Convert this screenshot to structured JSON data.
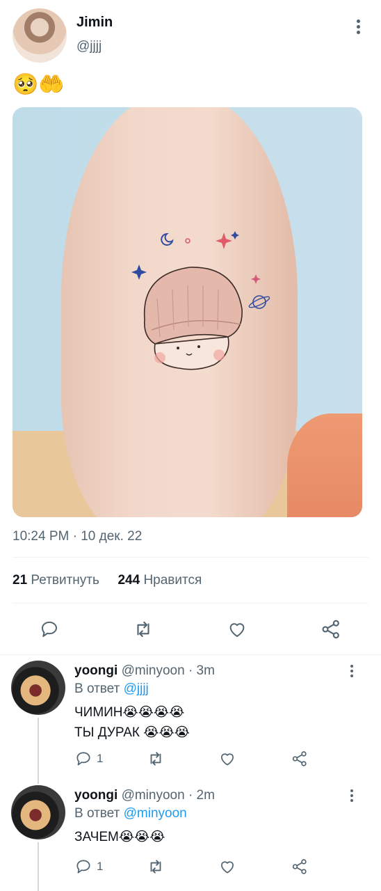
{
  "tweet": {
    "author_name": "Jimin",
    "author_handle": "@jjjj",
    "text": "🥺🤲",
    "timestamp": "10:24 PM · 10 дек. 22",
    "retweets_count": "21",
    "retweets_label": "Ретвитнуть",
    "likes_count": "244",
    "likes_label": "Нравится"
  },
  "actions": [
    "reply-icon",
    "retweet-icon",
    "like-icon",
    "share-icon"
  ],
  "replies": [
    {
      "author_name": "yoongi",
      "author_handle": "@minyoon · 3m",
      "in_reply_prefix": "В ответ ",
      "in_reply_to": "@jjjj",
      "text": "ЧИМИН😭😭😭😭\nТЫ ДУРАК 😭😭😭",
      "reply_count": "1"
    },
    {
      "author_name": "yoongi",
      "author_handle": "@minyoon · 2m",
      "in_reply_prefix": "В ответ ",
      "in_reply_to": "@minyoon",
      "text": "ЗАЧЕМ😭😭😭",
      "reply_count": "1"
    }
  ],
  "colors": {
    "secondary_text": "#536471",
    "link": "#1d9bf0",
    "divider": "#eff3f4"
  }
}
